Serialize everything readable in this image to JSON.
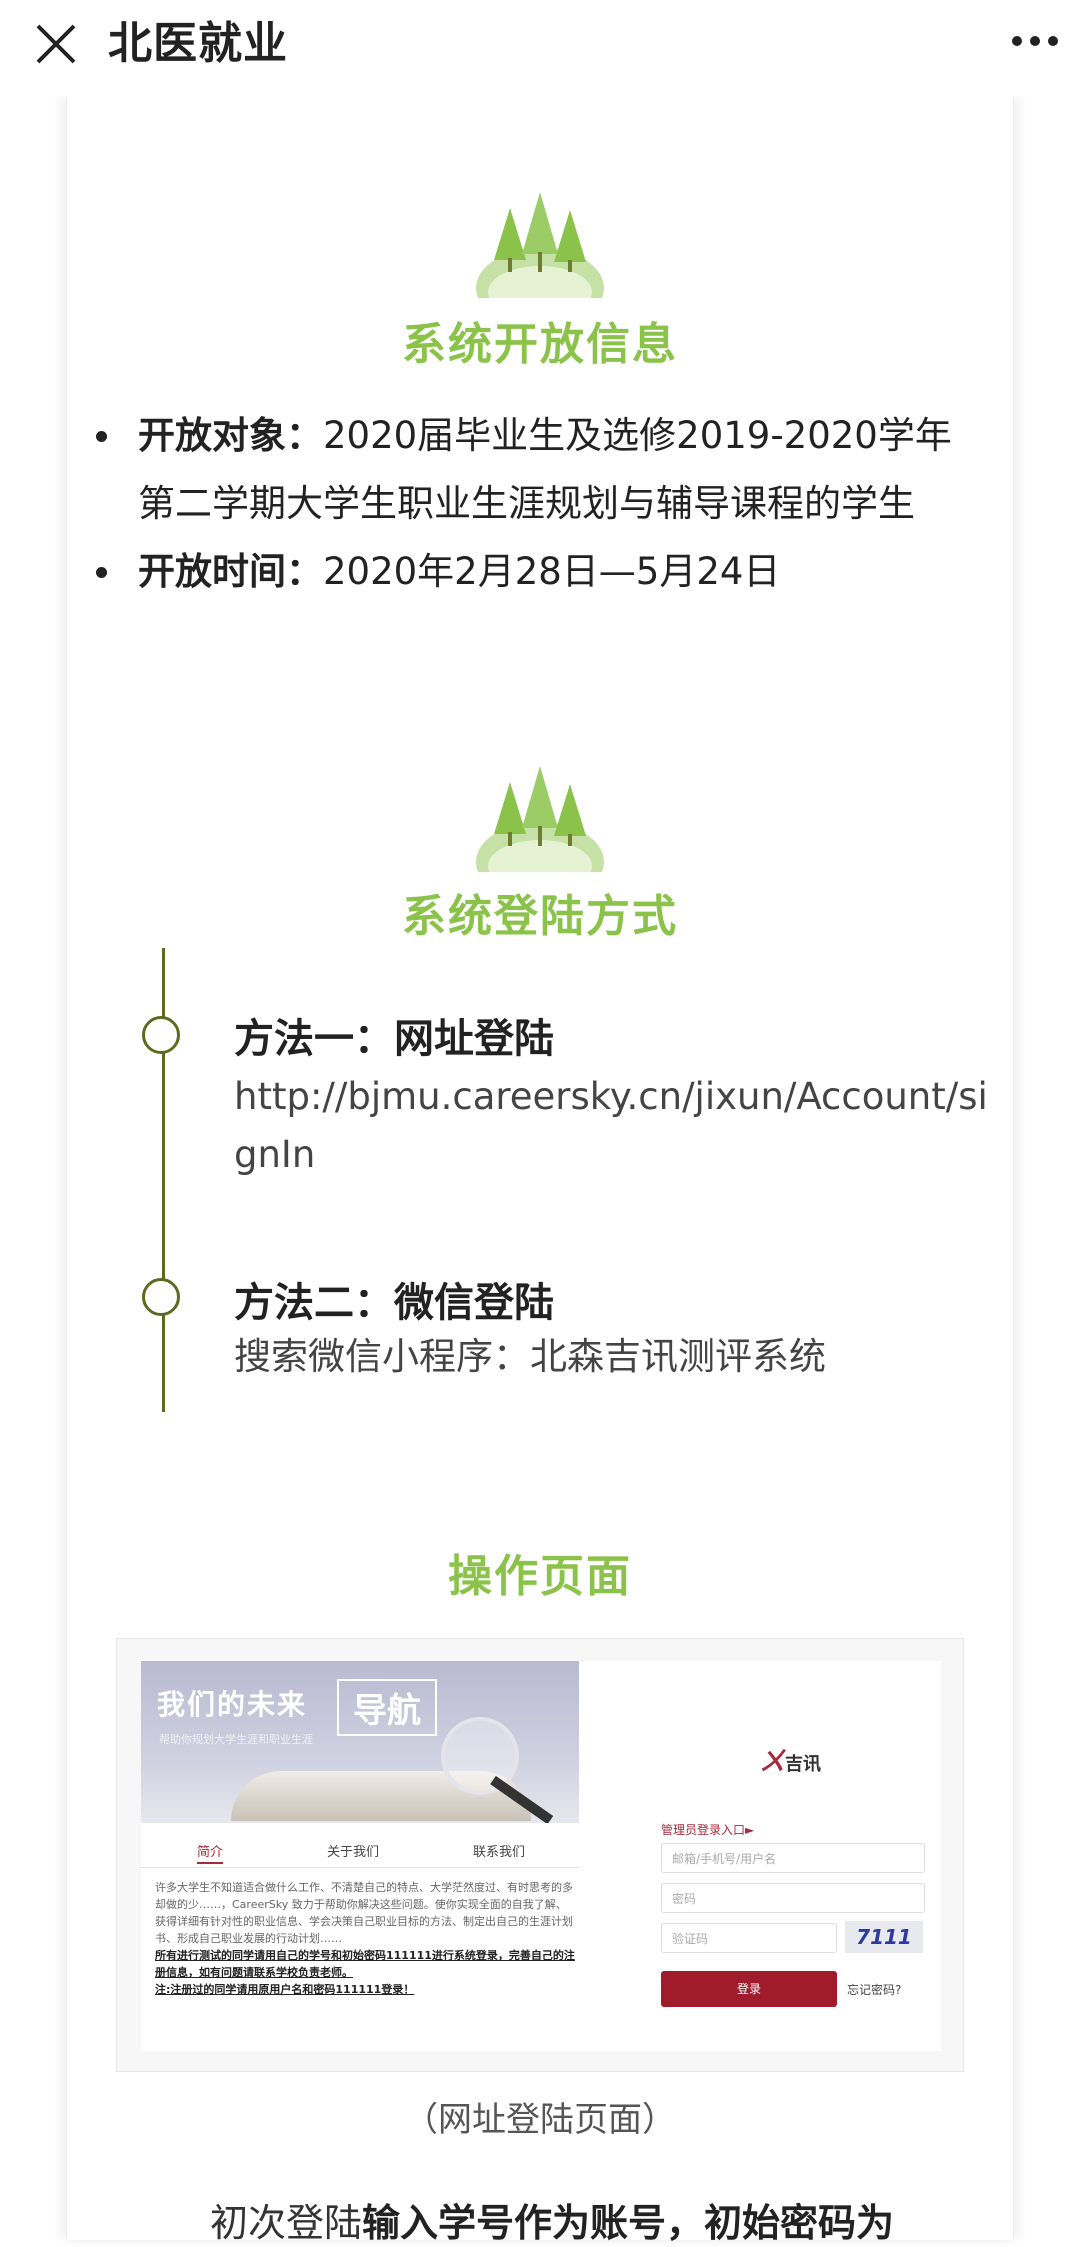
{
  "topbar": {
    "title": "北医就业",
    "close_icon": "close-icon",
    "more_icon": "more-icon"
  },
  "section1": {
    "title": "系统开放信息",
    "bullets": [
      {
        "label": "开放对象：",
        "text": "2020届毕业生及选修2019-2020学年第二学期大学生职业生涯规划与辅导课程的学生"
      },
      {
        "label": "开放时间：",
        "text": "2020年2月28日—5月24日"
      }
    ]
  },
  "section2": {
    "title": "系统登陆方式",
    "methods": [
      {
        "title": "方法一：网址登陆",
        "text": "http://bjmu.careersky.cn/jixun/Account/signIn"
      },
      {
        "title": "方法二：微信登陆",
        "text": "搜索微信小程序：北森吉讯测评系统"
      }
    ]
  },
  "section3": {
    "title": "操作页面"
  },
  "screenshot": {
    "banner_title": "我们的未来",
    "banner_nav": "导航",
    "banner_sub": "帮助你规划大学生涯和职业生涯",
    "tabs": [
      "简介",
      "关于我们",
      "联系我们"
    ],
    "intro_text": "许多大学生不知道适合做什么工作、不清楚自己的特点、大学茫然度过、有时思考的多却做的少……，CareerSky 致力于帮助你解决这些问题。使你实现全面的自我了解、获得详细有针对性的职业信息、学会决策自己职业目标的方法、制定出自己的生涯计划书、形成自己职业发展的行动计划……",
    "intro_bold_1": "所有进行测试的同学请用自己的学号和初始密码111111进行系统登录，完善自己的注册信息，如有问题请联系学校负责老师。",
    "intro_bold_2": "注:注册过的同学请用原用户名和密码111111登录！",
    "logo_text": "吉讯",
    "admin_link": "管理员登录入口►",
    "username_placeholder": "邮箱/手机号/用户名",
    "password_placeholder": "密码",
    "captcha_placeholder": "验证码",
    "captcha_code": "7111",
    "login_button": "登录",
    "forgot_link": "忘记密码?"
  },
  "caption": "（网址登陆页面）",
  "bottom": {
    "normal": "初次登陆",
    "bold": "输入学号作为账号，初始密码为"
  },
  "colors": {
    "accent_green": "#8bc34a",
    "timeline": "#5c6b1f",
    "login_red": "#a01c2c"
  }
}
